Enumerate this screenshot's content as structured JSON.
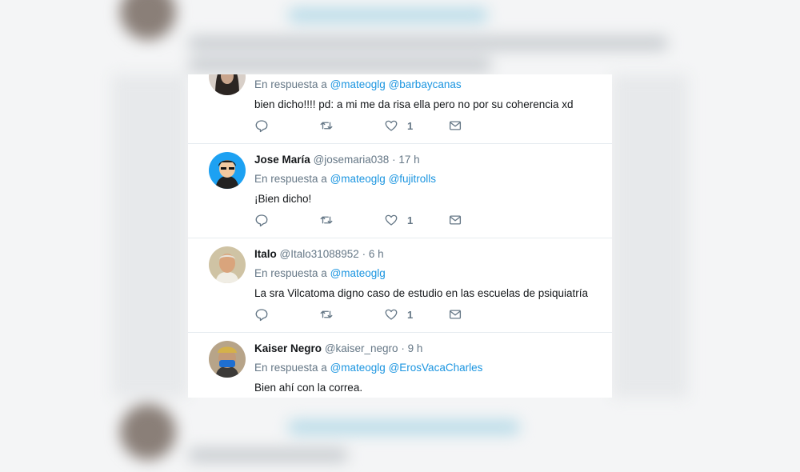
{
  "colors": {
    "link": "#1b95e0",
    "text": "#14171a",
    "muted": "#657786",
    "divider": "#e6ecf0"
  },
  "replies": [
    {
      "name": "",
      "handle": "",
      "dot": "",
      "time": "",
      "in_reply_prefix": "En respuesta a",
      "mentions": [
        "@mateoglg",
        "@barbaycanas"
      ],
      "text": "bien dicho!!!! pd: a mi me da risa ella pero no por su coherencia xd",
      "like_count": "1",
      "avatar_icon": "woman-dark-hair-avatar"
    },
    {
      "name": "Jose María",
      "handle": "@josemaria038",
      "dot": "·",
      "time": "17 h",
      "in_reply_prefix": "En respuesta a",
      "mentions": [
        "@mateoglg",
        "@fujitrolls"
      ],
      "text": "¡Bien dicho!",
      "like_count": "1",
      "avatar_icon": "cartoon-man-avatar"
    },
    {
      "name": "Italo",
      "handle": "@Italo31088952",
      "dot": "·",
      "time": "6 h",
      "in_reply_prefix": "En respuesta a",
      "mentions": [
        "@mateoglg"
      ],
      "text": "La sra Vilcatoma digno caso de estudio en las escuelas de psiquiatría",
      "like_count": "1",
      "avatar_icon": "older-man-avatar"
    },
    {
      "name": "Kaiser Negro",
      "handle": "@kaiser_negro",
      "dot": "·",
      "time": "9 h",
      "in_reply_prefix": "En respuesta a",
      "mentions": [
        "@mateoglg",
        "@ErosVacaCharles"
      ],
      "text": "Bien ahí con la correa.",
      "like_count": "",
      "avatar_icon": "masked-man-avatar"
    }
  ]
}
